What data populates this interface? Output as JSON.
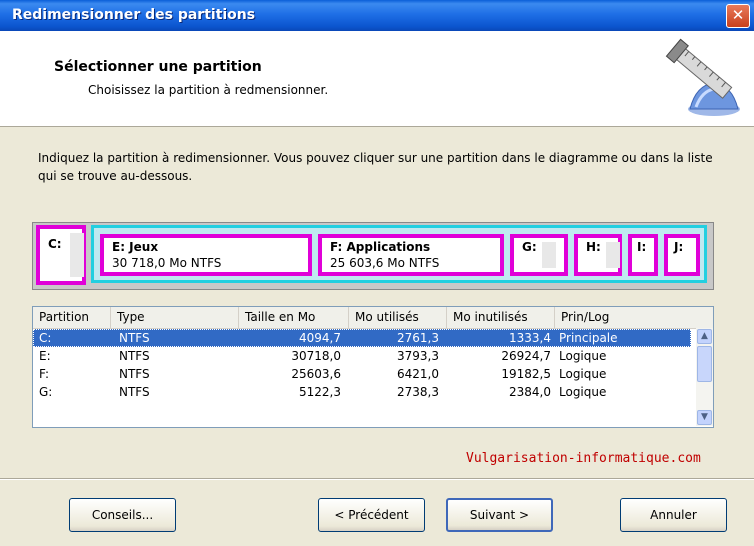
{
  "window": {
    "title": "Redimensionner des partitions",
    "close_glyph": "✕"
  },
  "header": {
    "title": "Sélectionner une partition",
    "subtitle": "Choisissez la partition à redmensionner.",
    "icon": "ruler-resize-icon"
  },
  "instructions": "Indiquez la partition à redimensionner. Vous pouvez cliquer sur une partition dans le diagramme ou dans la liste qui se trouve au-dessous.",
  "disk_map": {
    "primary": {
      "label": "C:"
    },
    "extended": [
      {
        "label": "E:  Jeux",
        "size": "30 718,0 Mo    NTFS"
      },
      {
        "label": "F:  Applications",
        "size": "25 603,6 Mo    NTFS"
      },
      {
        "label": "G:"
      },
      {
        "label": "H:"
      },
      {
        "label": "I:"
      },
      {
        "label": "J:"
      }
    ]
  },
  "list": {
    "columns": [
      "Partition",
      "Type",
      "Taille en Mo",
      "Mo utilisés",
      "Mo inutilisés",
      "Prin/Log"
    ],
    "rows": [
      {
        "partition": "C:",
        "type": "NTFS",
        "size": "4094,7",
        "used": "2761,3",
        "free": "1333,4",
        "kind": "Principale",
        "selected": true
      },
      {
        "partition": "E:",
        "type": "NTFS",
        "size": "30718,0",
        "used": "3793,3",
        "free": "26924,7",
        "kind": "Logique"
      },
      {
        "partition": "F:",
        "type": "NTFS",
        "size": "25603,6",
        "used": "6421,0",
        "free": "19182,5",
        "kind": "Logique"
      },
      {
        "partition": "G:",
        "type": "NTFS",
        "size": "5122,3",
        "used": "2738,3",
        "free": "2384,0",
        "kind": "Logique"
      }
    ]
  },
  "watermark": "Vulgarisation-informatique.com",
  "buttons": {
    "tips": "Conseils...",
    "back": "< Précédent",
    "next": "Suivant >",
    "cancel": "Annuler"
  },
  "colors": {
    "titlebar": "#0a5fd8",
    "partition_border": "#e000d8",
    "extended_border": "#22cfe0",
    "selection": "#316ac5"
  }
}
